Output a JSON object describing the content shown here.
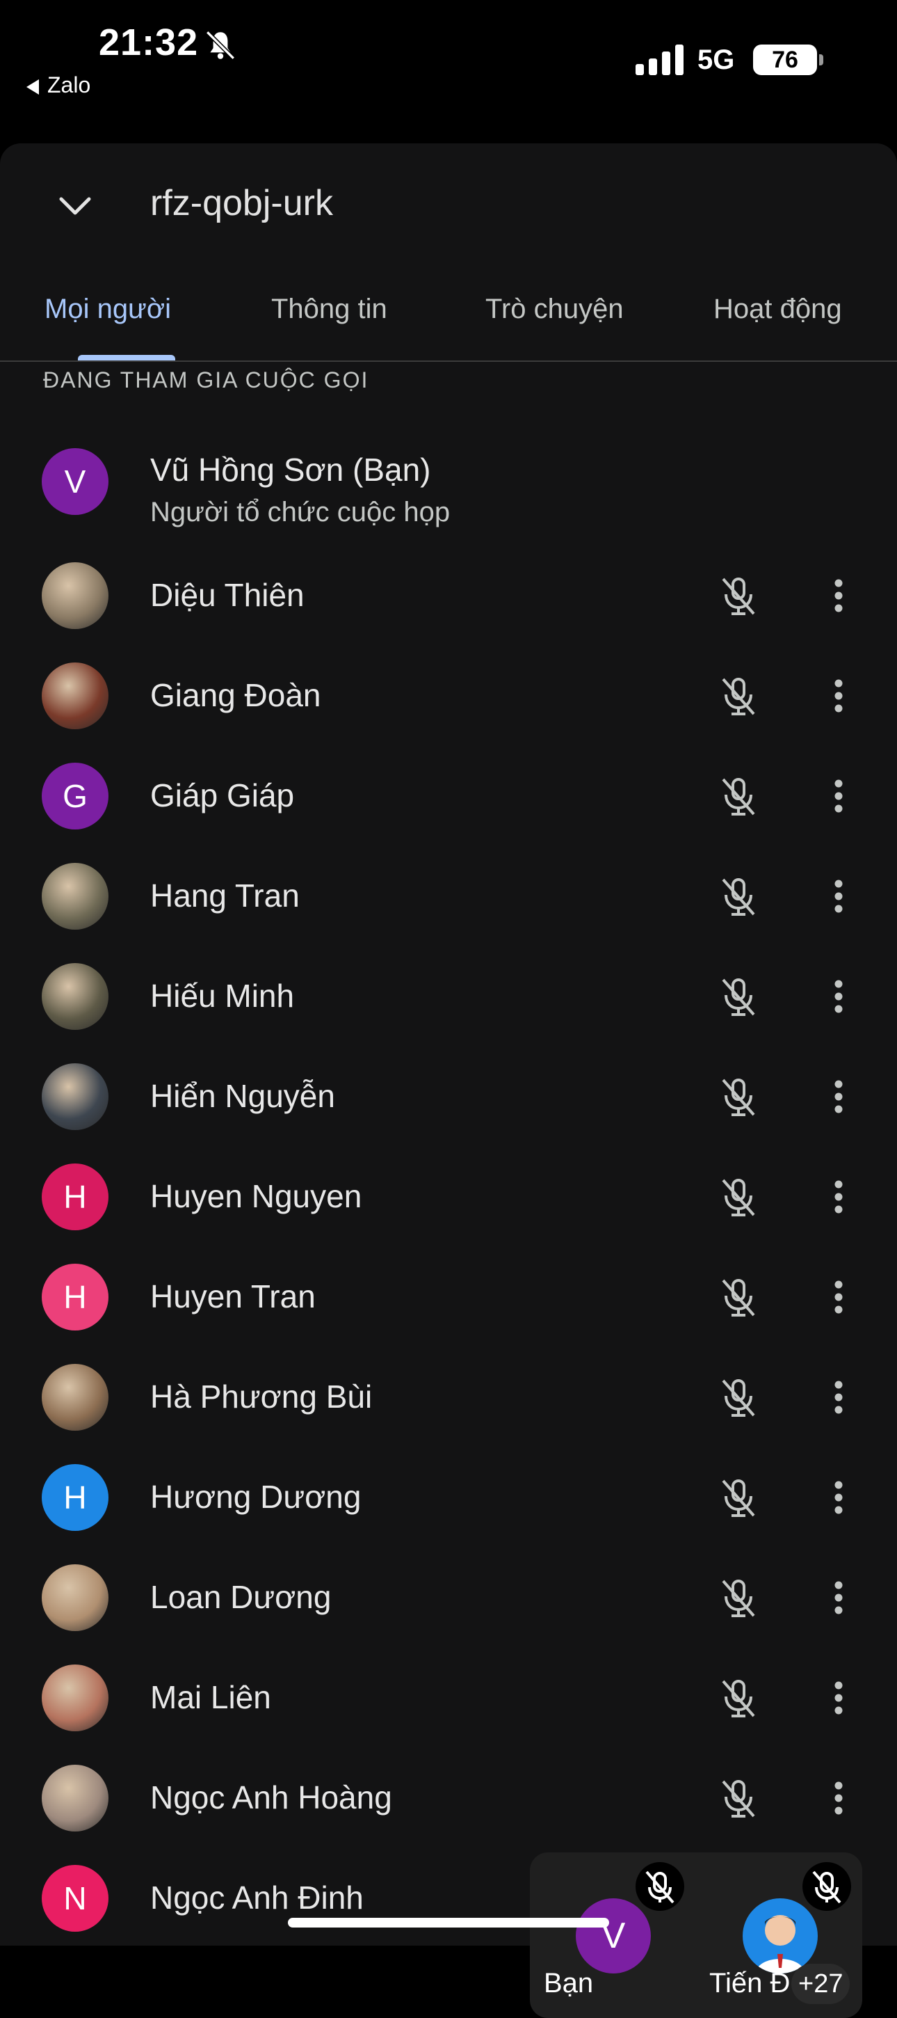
{
  "status": {
    "time": "21:32",
    "back_app": "Zalo",
    "network": "5G",
    "battery": "76"
  },
  "header": {
    "meeting_code": "rfz-qobj-urk"
  },
  "tabs": [
    {
      "label": "Mọi người"
    },
    {
      "label": "Thông tin"
    },
    {
      "label": "Trò chuyện"
    },
    {
      "label": "Hoạt động"
    }
  ],
  "section_label": "ĐANG THAM GIA CUỘC GỌI",
  "host": {
    "name": "Vũ Hồng Sơn (Bạn)",
    "role": "Người tổ chức cuộc họp",
    "initial": "V",
    "color": "#7b1fa2"
  },
  "participants": [
    {
      "name": "Diệu Thiên",
      "initial": "",
      "color": "#8a7a64"
    },
    {
      "name": "Giang Đoàn",
      "initial": "",
      "color": "#7a3a2a"
    },
    {
      "name": "Giáp Giáp",
      "initial": "G",
      "color": "#7b1fa2"
    },
    {
      "name": "Hang Tran",
      "initial": "",
      "color": "#6f6a55"
    },
    {
      "name": "Hiếu Minh",
      "initial": "",
      "color": "#5e5a47"
    },
    {
      "name": "Hiển Nguyễn",
      "initial": "",
      "color": "#3e4650"
    },
    {
      "name": "Huyen Nguyen",
      "initial": "H",
      "color": "#d81b60"
    },
    {
      "name": "Huyen Tran",
      "initial": "H",
      "color": "#ec407a"
    },
    {
      "name": "Hà Phương Bùi",
      "initial": "",
      "color": "#8d6e52"
    },
    {
      "name": "Hương Dương",
      "initial": "H",
      "color": "#1e88e5"
    },
    {
      "name": "Loan Dương",
      "initial": "",
      "color": "#b08f70"
    },
    {
      "name": "Mai Liên",
      "initial": "",
      "color": "#b5735e"
    },
    {
      "name": "Ngọc Anh Hoàng",
      "initial": "",
      "color": "#9e8a7e"
    },
    {
      "name": "Ngọc Anh Đinh",
      "initial": "N",
      "color": "#e91e63"
    }
  ],
  "pip": {
    "self_initial": "V",
    "self_label": "Bạn",
    "other_label": "Tiến Đ",
    "more_count": "+27"
  }
}
